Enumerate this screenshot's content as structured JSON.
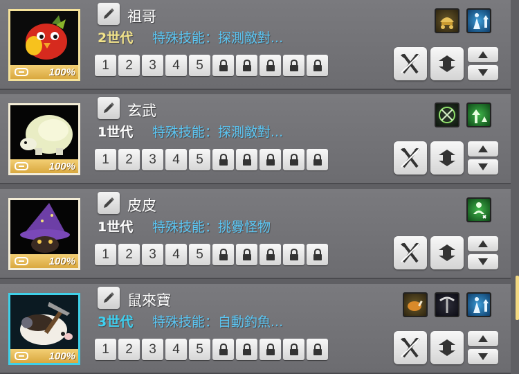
{
  "pets": [
    {
      "name": "祖哥",
      "generation": "2世代",
      "generation_color": "#f2e38a",
      "skill": "特殊技能：探測敵對...",
      "hp_percent": "100%",
      "portrait_frame": "gold",
      "portrait_art": "red-bird",
      "buffs": [
        "carriage-icon",
        "up-arrow-person-icon"
      ]
    },
    {
      "name": "玄武",
      "generation": "1世代",
      "generation_color": "#ffffff",
      "skill": "特殊技能：探測敵對...",
      "hp_percent": "100%",
      "portrait_frame": "white",
      "portrait_art": "tortoise",
      "buffs": [
        "crossed-swords-ring-icon",
        "speed-up-icon"
      ]
    },
    {
      "name": "皮皮",
      "generation": "1世代",
      "generation_color": "#ffffff",
      "skill": "特殊技能：挑釁怪物",
      "hp_percent": "100%",
      "portrait_frame": "white",
      "portrait_art": "wizard-hat",
      "buffs": [
        "recovery-icon"
      ]
    },
    {
      "name": "鼠來寶",
      "generation": "3世代",
      "generation_color": "#3fd0f0",
      "skill": "特殊技能：自動釣魚...",
      "hp_percent": "100%",
      "portrait_frame": "blue",
      "portrait_art": "hamster-miner",
      "buffs": [
        "roast-chicken-icon",
        "pickaxe-icon",
        "up-arrow-person-icon"
      ]
    }
  ],
  "slot_labels": [
    "1",
    "2",
    "3",
    "4",
    "5"
  ],
  "locked_slot_count": 5,
  "colors": {
    "skill_text": "#5cc6f3",
    "card_bg": "#757579"
  }
}
